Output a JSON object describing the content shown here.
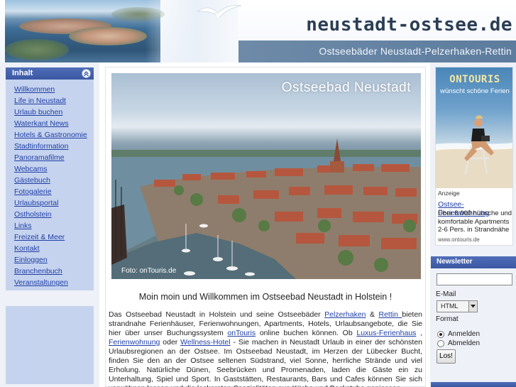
{
  "header": {
    "site_title": "neustadt-ostsee.de",
    "subtitle": "Ostseebäder Neustadt-Pelzerhaken-Rettin"
  },
  "nav": {
    "title": "Inhalt",
    "items": [
      {
        "label": "Willkommen"
      },
      {
        "label": "Life in Neustadt"
      },
      {
        "label": "Urlaub buchen"
      },
      {
        "label": "Waterkant News"
      },
      {
        "label": "Hotels & Gastronomie"
      },
      {
        "label": "Stadtinformation"
      },
      {
        "label": "Panoramafilme"
      },
      {
        "label": "Webcams"
      },
      {
        "label": "Gästebuch"
      },
      {
        "label": "Fotogalerie"
      },
      {
        "label": "Urlaubsportal"
      },
      {
        "label": "Ostholstein"
      },
      {
        "label": "Links"
      },
      {
        "label": "Freizeit & Meer"
      },
      {
        "label": "Kontakt"
      },
      {
        "label": "Einloggen"
      },
      {
        "label": "Branchenbuch"
      },
      {
        "label": "Veranstaltungen"
      }
    ]
  },
  "main": {
    "hero_caption": "Ostseebad Neustadt",
    "hero_credit": "Foto: onTouris.de",
    "welcome": "Moin moin und Willkommen im Ostseebad Neustadt in Holstein !",
    "intro": {
      "t1": "Das Ostseebad Neustadt in Holstein und seine Ostseebäder ",
      "link1": "Pelzerhaken",
      "t2": " & ",
      "link2": "Rettin ",
      "t3": "bieten strandnahe Ferienhäuser, Ferienwohnungen, Apartments, Hotels, Urlaubsangebote, die Sie hier über unser Buchungssystem ",
      "link3": "onTouris",
      "t4": " online buchen können. Ob ",
      "link4": "Luxus-Ferienhaus",
      "t5": " , ",
      "link5": "Ferienwohnung",
      "t6": " oder ",
      "link6": "Wellness-Hotel",
      "t7": " - Sie machen in Neustadt Urlaub in einer der schönsten Urlaubsregionen an der Ostsee. Im Ostseebad Neustadt, im Herzen der Lübecker Bucht, finden Sie den an der Ostsee seltenen Südstrand, viel Sonne, herrliche Strände und viel Erholung. Natürliche Dünen, Seebrücken und Promenaden, laden die Gäste ein zu Unterhaltung, Spiel und Sport. In Gaststätten, Restaurants, Bars und Cafes können Sie sich verwöhnen lassen und die leckersten Spezialitäten aus Küche und Backstube geniessen."
    }
  },
  "ad": {
    "logo": "ONTOURIS",
    "tagline": "wünscht schöne Ferien",
    "label": "Anzeige",
    "link": "Ostsee-Ferienwohnung",
    "text": "Über 8.000 hübsche und komfortable Apartments 2-6 Pers. in Strandnähe",
    "url": "www.ontouris.de"
  },
  "newsletter": {
    "title": "Newsletter",
    "email_label": "E-Mail",
    "email_value": "",
    "format_selected": "HTML",
    "format_label": "Format",
    "subscribe_label": "Anmelden",
    "unsubscribe_label": "Abmelden",
    "submit_label": "Los!"
  },
  "colors": {
    "nav_header": "#3b57a3",
    "nav_bg": "#c6d3ee",
    "link": "#1f3fa6",
    "subtitle_bar": "#5d7c9e"
  }
}
